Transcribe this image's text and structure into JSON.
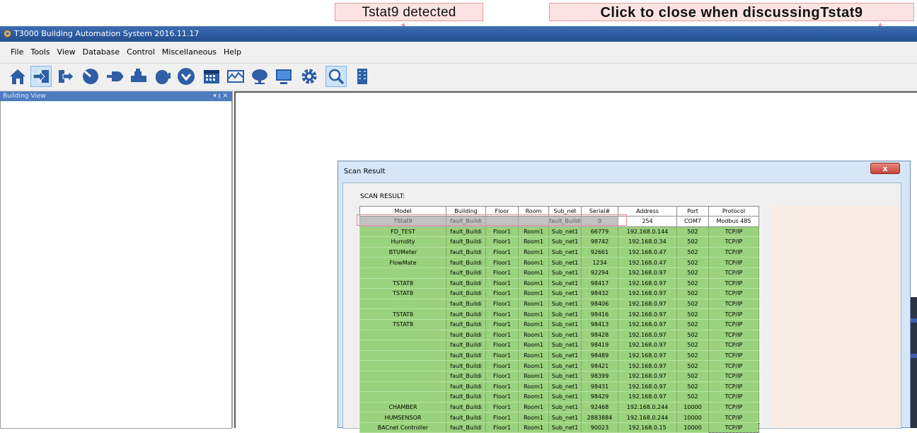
{
  "annotations": {
    "tstat9_detected": "Tstat9 detected",
    "click_to_close": "Click  to close when discussingTstat9"
  },
  "window": {
    "title": "T3000 Building Automation System  2016.11.17",
    "accent_color": "#2c5aa0"
  },
  "menu": [
    "File",
    "Tools",
    "View",
    "Database",
    "Control",
    "Miscellaneous",
    "Help"
  ],
  "toolbar": {
    "icons": [
      "home-icon",
      "login-icon",
      "logout-icon",
      "dial-icon",
      "input-icon",
      "output-icon",
      "fan-icon",
      "dropdown-icon",
      "calendar-icon",
      "graph-icon",
      "alarm-icon",
      "monitor-icon",
      "settings-icon",
      "scan-icon",
      "building-icon"
    ],
    "active_icon": "scan-icon"
  },
  "building_view": {
    "title": "Building View",
    "controls": "▾ ⫾ ✕"
  },
  "scan_dialog": {
    "title": "Scan Result",
    "close_label": "x",
    "heading": "SCAN RESULT:",
    "columns": [
      "Model",
      "Building",
      "Floor",
      "Room",
      "Sub_net",
      "Serial#",
      "Address",
      "Port",
      "Protocol"
    ],
    "selected_row": [
      "TStat9",
      "fault_Buildi",
      "",
      "",
      "fault_Buildi",
      "0",
      "254",
      "COM7",
      "Modbus 485"
    ],
    "rows": [
      [
        "FD_TEST",
        "fault_Buildi",
        "Floor1",
        "Room1",
        "Sub_net1",
        "66779",
        "192.168.0.144",
        "502",
        "TCP/IP"
      ],
      [
        "Humdity",
        "fault_Buildi",
        "Floor1",
        "Room1",
        "Sub_net1",
        "98742",
        "192.168.0.34",
        "502",
        "TCP/IP"
      ],
      [
        "BTUMeter",
        "fault_Buildi",
        "Floor1",
        "Room1",
        "Sub_net1",
        "92661",
        "192.168.0.47",
        "502",
        "TCP/IP"
      ],
      [
        "FlowMate",
        "fault_Buildi",
        "Floor1",
        "Room1",
        "Sub_net1",
        "1234",
        "192.168.0.47",
        "502",
        "TCP/IP"
      ],
      [
        "",
        "fault_Buildi",
        "Floor1",
        "Room1",
        "Sub_net1",
        "92294",
        "192.168.0.97",
        "502",
        "TCP/IP"
      ],
      [
        "TSTAT8",
        "fault_Buildi",
        "Floor1",
        "Room1",
        "Sub_net1",
        "98417",
        "192.168.0.97",
        "502",
        "TCP/IP"
      ],
      [
        "TSTAT8",
        "fault_Buildi",
        "Floor1",
        "Room1",
        "Sub_net1",
        "98432",
        "192.168.0.97",
        "502",
        "TCP/IP"
      ],
      [
        "",
        "fault_Buildi",
        "Floor1",
        "Room1",
        "Sub_net1",
        "98406",
        "192.168.0.97",
        "502",
        "TCP/IP"
      ],
      [
        "TSTAT8",
        "fault_Buildi",
        "Floor1",
        "Room1",
        "Sub_net1",
        "98416",
        "192.168.0.97",
        "502",
        "TCP/IP"
      ],
      [
        "TSTAT8",
        "fault_Buildi",
        "Floor1",
        "Room1",
        "Sub_net1",
        "98413",
        "192.168.0.97",
        "502",
        "TCP/IP"
      ],
      [
        "",
        "fault_Buildi",
        "Floor1",
        "Room1",
        "Sub_net1",
        "98428",
        "192.168.0.97",
        "502",
        "TCP/IP"
      ],
      [
        "",
        "fault_Buildi",
        "Floor1",
        "Room1",
        "Sub_net1",
        "98419",
        "192.168.0.97",
        "502",
        "TCP/IP"
      ],
      [
        "",
        "fault_Buildi",
        "Floor1",
        "Room1",
        "Sub_net1",
        "98489",
        "192.168.0.97",
        "502",
        "TCP/IP"
      ],
      [
        "",
        "fault_Buildi",
        "Floor1",
        "Room1",
        "Sub_net1",
        "98421",
        "192.168.0.97",
        "502",
        "TCP/IP"
      ],
      [
        "",
        "fault_Buildi",
        "Floor1",
        "Room1",
        "Sub_net1",
        "98399",
        "192.168.0.97",
        "502",
        "TCP/IP"
      ],
      [
        "",
        "fault_Buildi",
        "Floor1",
        "Room1",
        "Sub_net1",
        "98431",
        "192.168.0.97",
        "502",
        "TCP/IP"
      ],
      [
        "",
        "fault_Buildi",
        "Floor1",
        "Room1",
        "Sub_net1",
        "98429",
        "192.168.0.97",
        "502",
        "TCP/IP"
      ],
      [
        "CHAMBER",
        "fault_Buildi",
        "Floor1",
        "Room1",
        "Sub_net1",
        "92468",
        "192.168.0.244",
        "10000",
        "TCP/IP"
      ],
      [
        "HUMSENSOR",
        "fault_Buildi",
        "Floor1",
        "Room1",
        "Sub_net1",
        "2883884",
        "192.168.0.244",
        "10000",
        "TCP/IP"
      ],
      [
        "BACnet Controller",
        "fault_Buildi",
        "Floor1",
        "Room1",
        "Sub_net1",
        "90023",
        "192.168.0.15",
        "10000",
        "TCP/IP"
      ]
    ],
    "row_color": "#9ad27d",
    "selected_color": "#c2c2c2"
  }
}
